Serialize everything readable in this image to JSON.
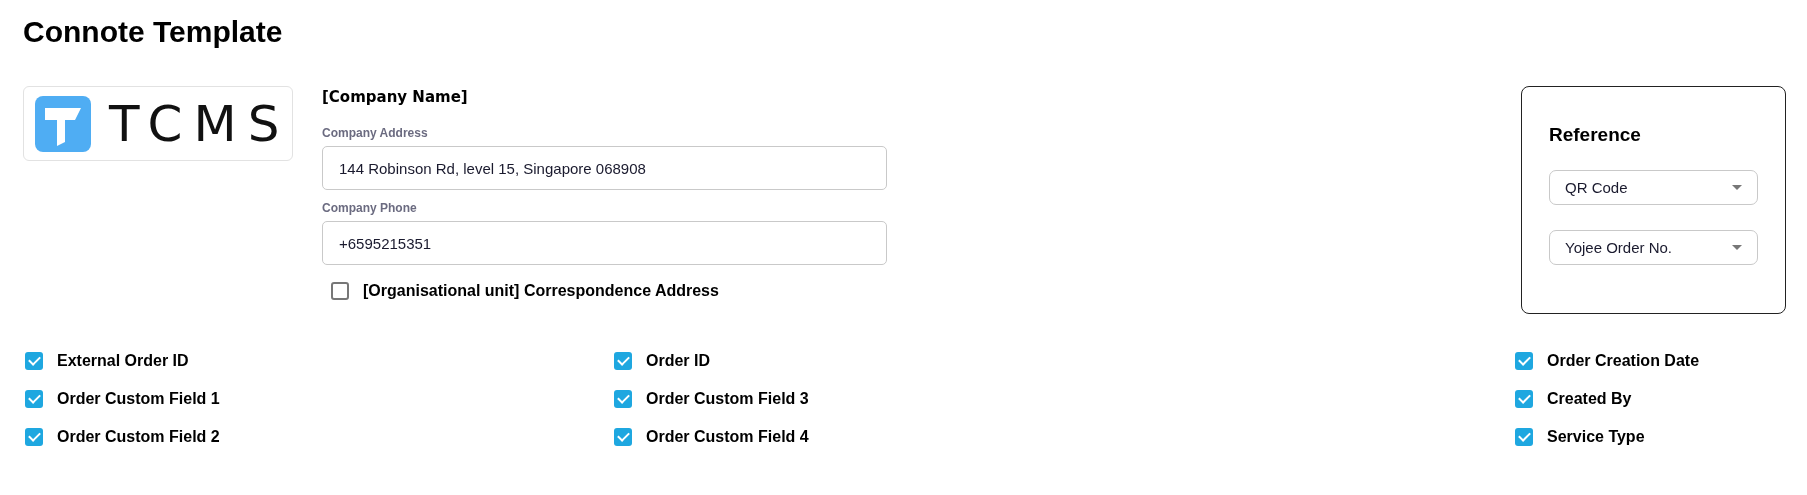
{
  "title": "Connote Template",
  "logo": {
    "text": "TCMS"
  },
  "company": {
    "name": "[Company Name]",
    "fields": [
      {
        "label": "Company Address",
        "value": "144 Robinson Rd, level 15, Singapore 068908"
      },
      {
        "label": "Company Phone",
        "value": "+6595215351"
      }
    ],
    "correspondence": {
      "label": "[Organisational unit] Correspondence Address",
      "checked": false
    }
  },
  "reference": {
    "title": "Reference",
    "selects": [
      {
        "value": "QR Code"
      },
      {
        "value": "Yojee Order No."
      }
    ]
  },
  "fields": [
    [
      {
        "label": "External Order ID",
        "checked": true
      },
      {
        "label": "Order Custom Field 1",
        "checked": true
      },
      {
        "label": "Order Custom Field 2",
        "checked": true
      }
    ],
    [
      {
        "label": "Order ID",
        "checked": true
      },
      {
        "label": "Order Custom Field 3",
        "checked": true
      },
      {
        "label": "Order Custom Field 4",
        "checked": true
      }
    ],
    [
      {
        "label": "Order Creation Date",
        "checked": true
      },
      {
        "label": "Created By",
        "checked": true
      },
      {
        "label": "Service Type",
        "checked": true
      }
    ]
  ]
}
